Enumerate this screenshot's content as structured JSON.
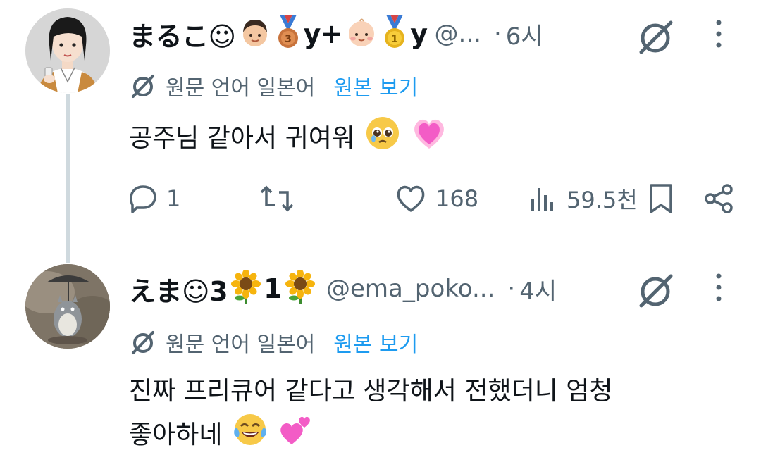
{
  "colors": {
    "text": "#0f1419",
    "secondary": "#536471",
    "link": "#1d9bf0",
    "thread_line": "#cfd9de"
  },
  "posts": [
    {
      "display_name": "まるこ☺",
      "badges": [
        "boy-emoji",
        "bronze-medal-emoji",
        "y+",
        "baby-emoji",
        "gold-medal-emoji",
        "y"
      ],
      "badge_text_1": "y+",
      "badge_text_2": "y",
      "handle": "@...",
      "time": "6시",
      "translation_label": "원문 언어 일본어",
      "translation_link": "원본 보기",
      "text": "공주님 같아서 귀여워",
      "text_emojis": [
        "pleading-face-emoji",
        "growing-heart-emoji"
      ],
      "actions": {
        "replies": "1",
        "reposts": "",
        "likes": "168",
        "views": "59.5천"
      }
    },
    {
      "display_name": "えま☺3",
      "badges": [
        "sunflower-emoji",
        "1",
        "sunflower-emoji"
      ],
      "badge_text_1": "1",
      "handle": "@ema_poko...",
      "time": "4시",
      "translation_label": "원문 언어 일본어",
      "translation_link": "원본 보기",
      "text_line1": "진짜 프리큐어 같다고 생각해서 전했더니 엄청",
      "text_line2": "좋아하네",
      "text_emojis": [
        "tears-of-joy-emoji",
        "two-hearts-emoji"
      ]
    }
  ]
}
